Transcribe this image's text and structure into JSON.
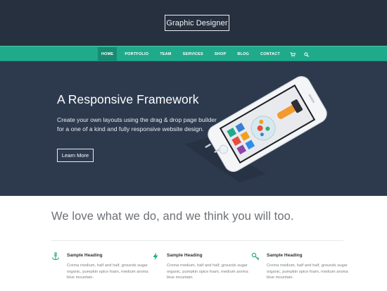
{
  "site": {
    "title": "Graphic Designer"
  },
  "nav": {
    "items": [
      {
        "label": "HOME"
      },
      {
        "label": "PORTFOLIO"
      },
      {
        "label": "TEAM"
      },
      {
        "label": "SERVICES"
      },
      {
        "label": "SHOP"
      },
      {
        "label": "BLOG"
      },
      {
        "label": "CONTACT"
      }
    ],
    "icons": [
      "cart-icon",
      "search-icon"
    ]
  },
  "hero": {
    "title": "A Responsive Framework",
    "text": "Create your own layouts using the drag & drop page builder for a one of a kind and fully responsive website design.",
    "button_label": "Learn More"
  },
  "tagline": "We love what we do, and we think you will too.",
  "features": [
    {
      "icon": "anchor-icon",
      "heading": "Sample Heading",
      "text": "Crema medium, half and half, grounds sugar organic, pumpkin spice foam, medium aroma blue mountain."
    },
    {
      "icon": "lightning-icon",
      "heading": "Sample Heading",
      "text": "Crema medium, half and half, grounds sugar organic, pumpkin spice foam, medium aroma blue mountain."
    },
    {
      "icon": "key-icon",
      "heading": "Sample Heading",
      "text": "Crema medium, half and half, grounds sugar organic, pumpkin spice foam, medium aroma blue mountain."
    }
  ],
  "colors": {
    "header": "#27303f",
    "accent": "#1faa8b",
    "hero": "#2d3a4e"
  }
}
